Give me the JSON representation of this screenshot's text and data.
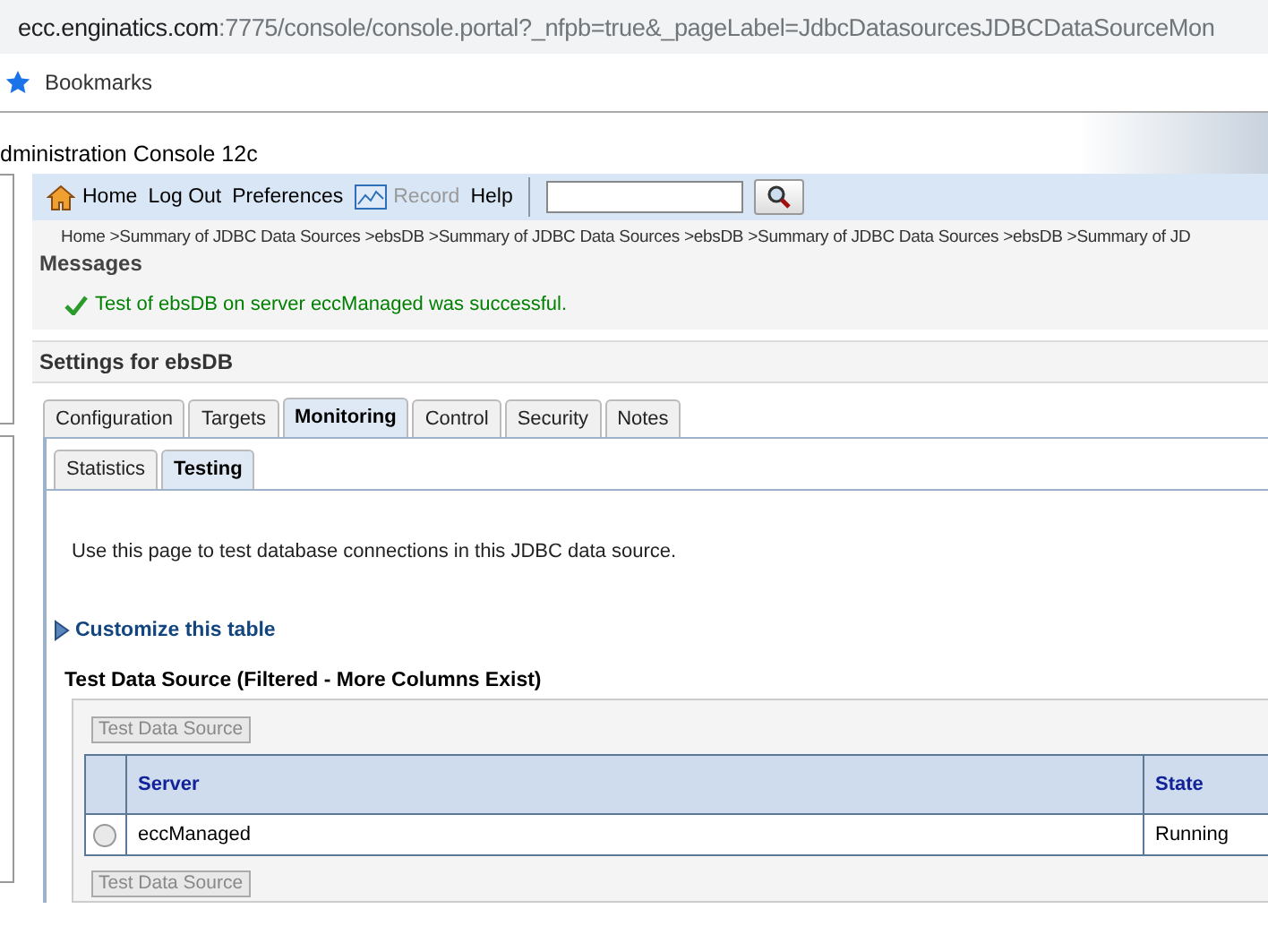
{
  "browser": {
    "url_host": "ecc.enginatics.com",
    "url_rest": ":7775/console/console.portal?_nfpb=true&_pageLabel=JdbcDatasourcesJDBCDataSourceMon",
    "bookmarks": "Bookmarks"
  },
  "console_title": "dministration Console 12c",
  "toolbar": [
    {
      "label": "Home",
      "kind": "home",
      "disabled": false
    },
    {
      "label": "Log Out",
      "kind": "link",
      "disabled": false
    },
    {
      "label": "Preferences",
      "kind": "link",
      "disabled": false
    },
    {
      "label": "Record",
      "kind": "record",
      "disabled": true
    },
    {
      "label": "Help",
      "kind": "link",
      "disabled": false
    }
  ],
  "breadcrumb": "Home >Summary of JDBC Data Sources >ebsDB >Summary of JDBC Data Sources >ebsDB >Summary of JDBC Data Sources >ebsDB >Summary of JD",
  "messages": {
    "title": "Messages",
    "text": "Test of ebsDB on server eccManaged was successful."
  },
  "settings": {
    "title": "Settings for ebsDB",
    "tabs": [
      {
        "label": "Configuration",
        "selected": false
      },
      {
        "label": "Targets",
        "selected": false
      },
      {
        "label": "Monitoring",
        "selected": true
      },
      {
        "label": "Control",
        "selected": false
      },
      {
        "label": "Security",
        "selected": false
      },
      {
        "label": "Notes",
        "selected": false
      }
    ],
    "subtabs": [
      {
        "label": "Statistics",
        "selected": false
      },
      {
        "label": "Testing",
        "selected": true
      }
    ],
    "description": "Use this page to test database connections in this JDBC data source.",
    "customize": "Customize this table",
    "table_title": "Test Data Source (Filtered - More Columns Exist)",
    "buttons": [
      {
        "label": "Test Data Source",
        "disabled": true
      },
      {
        "label": "Test Data Source",
        "disabled": true
      }
    ],
    "columns": [
      "Server",
      "State"
    ],
    "rows": [
      {
        "selected": false,
        "server": "eccManaged",
        "state": "Running"
      }
    ]
  }
}
